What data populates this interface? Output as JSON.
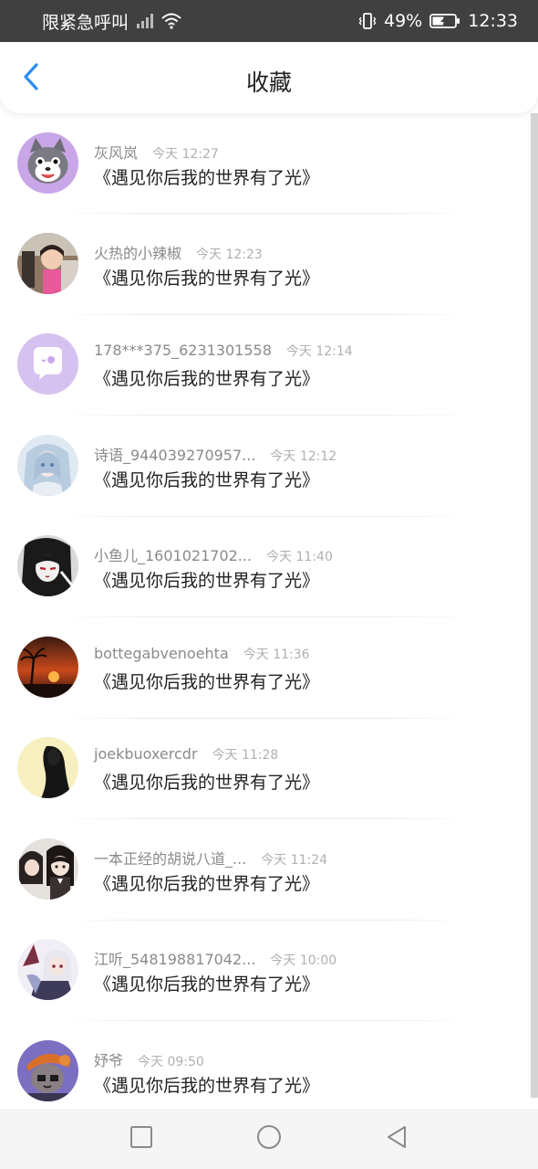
{
  "status_bar": {
    "left_text": "限紧急呼叫",
    "battery_percent": "49%",
    "time": "12:33",
    "icons": [
      "signal-icon",
      "wifi-icon",
      "vibrate-icon",
      "battery-charging-icon"
    ]
  },
  "header": {
    "title": "收藏",
    "back_icon": "chevron-left-icon",
    "accent_color": "#2d8cf0"
  },
  "favorites": [
    {
      "name": "灰风岚",
      "time": "今天 12:27",
      "title": "《遇见你后我的世界有了光》",
      "avatar": "gray-wolf-cartoon"
    },
    {
      "name": "火热的小辣椒",
      "time": "今天 12:23",
      "title": "《遇见你后我的世界有了光》",
      "avatar": "girl-photo"
    },
    {
      "name": "178***375_6231301558",
      "time": "今天 12:14",
      "title": "《遇见你后我的世界有了光》",
      "avatar": "default-chat-bubble"
    },
    {
      "name": "诗语_944039270957...",
      "time": "今天 12:12",
      "title": "《遇见你后我的世界有了光》",
      "avatar": "anime-girl-blue"
    },
    {
      "name": "小鱼儿_1601021702...",
      "time": "今天 11:40",
      "title": "《遇见你后我的世界有了光》",
      "avatar": "anime-girl-dark"
    },
    {
      "name": "bottegabvenoehta",
      "time": "今天 11:36",
      "title": "《遇见你后我的世界有了光》",
      "avatar": "sunset-palm"
    },
    {
      "name": "joekbuoxercdr",
      "time": "今天 11:28",
      "title": "《遇见你后我的世界有了光》",
      "avatar": "silhouette-yellow"
    },
    {
      "name": "一本正经的胡说八道_...",
      "time": "今天 11:24",
      "title": "《遇见你后我的世界有了光》",
      "avatar": "anime-pair"
    },
    {
      "name": "江听_548198817042...",
      "time": "今天 10:00",
      "title": "《遇见你后我的世界有了光》",
      "avatar": "anime-white-hair"
    },
    {
      "name": "妤爷",
      "time": "今天 09:50",
      "title": "《遇见你后我的世界有了光》",
      "avatar": "cartoon-hat"
    }
  ],
  "bottom_nav": {
    "icons": [
      "recent-apps-square-icon",
      "home-circle-icon",
      "back-triangle-icon"
    ]
  }
}
